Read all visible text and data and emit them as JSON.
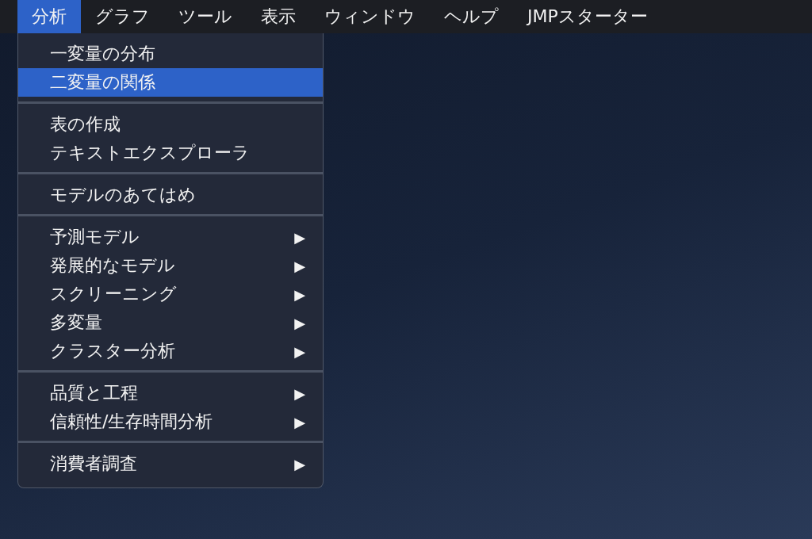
{
  "menubar": [
    {
      "label": "分析",
      "selected": true
    },
    {
      "label": "グラフ",
      "selected": false
    },
    {
      "label": "ツール",
      "selected": false
    },
    {
      "label": "表示",
      "selected": false
    },
    {
      "label": "ウィンドウ",
      "selected": false
    },
    {
      "label": "ヘルプ",
      "selected": false
    },
    {
      "label": "JMPスターター",
      "selected": false
    }
  ],
  "menu": {
    "groups": [
      {
        "items": [
          {
            "label": "一変量の分布",
            "selected": false
          },
          {
            "label": "二変量の関係",
            "selected": true
          }
        ]
      },
      {
        "items": [
          {
            "label": "表の作成",
            "selected": false
          },
          {
            "label": "テキストエクスプローラ",
            "selected": false
          }
        ]
      },
      {
        "items": [
          {
            "label": "モデルのあてはめ",
            "selected": false
          }
        ]
      },
      {
        "items": [
          {
            "label": "予測モデル",
            "selected": false,
            "arrow": "▶"
          },
          {
            "label": "発展的なモデル",
            "selected": false,
            "arrow": "▶"
          },
          {
            "label": "スクリーニング",
            "selected": false,
            "arrow": "▶"
          },
          {
            "label": "多変量",
            "selected": false,
            "arrow": "▶"
          },
          {
            "label": "クラスター分析",
            "selected": false,
            "arrow": "▶"
          }
        ]
      },
      {
        "items": [
          {
            "label": "品質と工程",
            "selected": false,
            "arrow": "▶"
          },
          {
            "label": "信頼性/生存時間分析",
            "selected": false,
            "arrow": "▶"
          }
        ]
      },
      {
        "items": [
          {
            "label": "消費者調査",
            "selected": false,
            "arrow": "▶"
          }
        ]
      }
    ]
  }
}
